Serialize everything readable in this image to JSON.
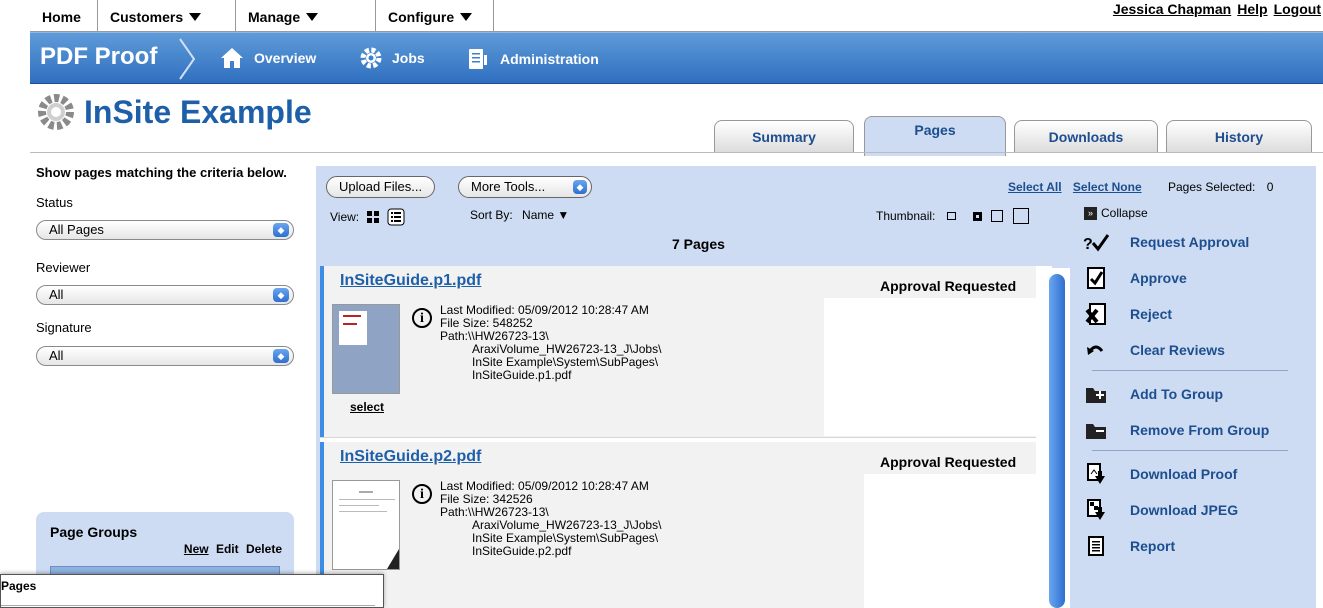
{
  "topmenu": {
    "items": [
      "Home",
      "Customers",
      "Manage",
      "Configure"
    ],
    "user": "Jessica Chapman",
    "help": "Help",
    "logout": "Logout"
  },
  "navbar": {
    "brand": "PDF Proof",
    "links": [
      "Overview",
      "Jobs",
      "Administration"
    ]
  },
  "page": {
    "title": "InSite Example"
  },
  "tabs": [
    "Summary",
    "Pages",
    "Downloads",
    "History"
  ],
  "active_tab": "Pages",
  "filters": {
    "heading": "Show pages matching the criteria below.",
    "status_label": "Status",
    "status_value": "All Pages",
    "reviewer_label": "Reviewer",
    "reviewer_value": "All",
    "signature_label": "Signature",
    "signature_value": "All"
  },
  "page_groups": {
    "title": "Page Groups",
    "new": "New",
    "edit": "Edit",
    "delete": "Delete"
  },
  "toolbar": {
    "upload": "Upload Files...",
    "more_tools": "More Tools...",
    "select_all": "Select All",
    "select_none": "Select None",
    "pages_selected_label": "Pages Selected:",
    "pages_selected_count": "0",
    "view_label": "View:",
    "sort_label": "Sort By:",
    "sort_value": "Name",
    "thumbnail_label": "Thumbnail:",
    "pages_count": "7 Pages"
  },
  "items": [
    {
      "filename": "InSiteGuide.p1.pdf",
      "status": "Approval Requested",
      "modified": "Last Modified: 05/09/2012 10:28:47 AM",
      "size": "File Size: 548252",
      "path1": "Path:\\\\HW26723-13\\",
      "path2": "AraxiVolume_HW26723-13_J\\Jobs\\",
      "path3": "InSite Example\\System\\SubPages\\",
      "path4": "InSiteGuide.p1.pdf",
      "select": "select"
    },
    {
      "filename": "InSiteGuide.p2.pdf",
      "status": "Approval Requested",
      "modified": "Last Modified: 05/09/2012 10:28:47 AM",
      "size": "File Size: 342526",
      "path1": "Path:\\\\HW26723-13\\",
      "path2": "AraxiVolume_HW26723-13_J\\Jobs\\",
      "path3": "InSite Example\\System\\SubPages\\",
      "path4": "InSiteGuide.p2.pdf"
    }
  ],
  "actions": {
    "collapse": "Collapse",
    "request_approval": "Request Approval",
    "approve": "Approve",
    "reject": "Reject",
    "clear_reviews": "Clear Reviews",
    "add_to_group": "Add To Group",
    "remove_from_group": "Remove From Group",
    "download_proof": "Download Proof",
    "download_jpeg": "Download JPEG",
    "report": "Report"
  },
  "popup": {
    "title": "Pages"
  },
  "colors": {
    "accent": "#2f6fbf",
    "panel": "#cddcf2",
    "link": "#1d5fa8"
  }
}
